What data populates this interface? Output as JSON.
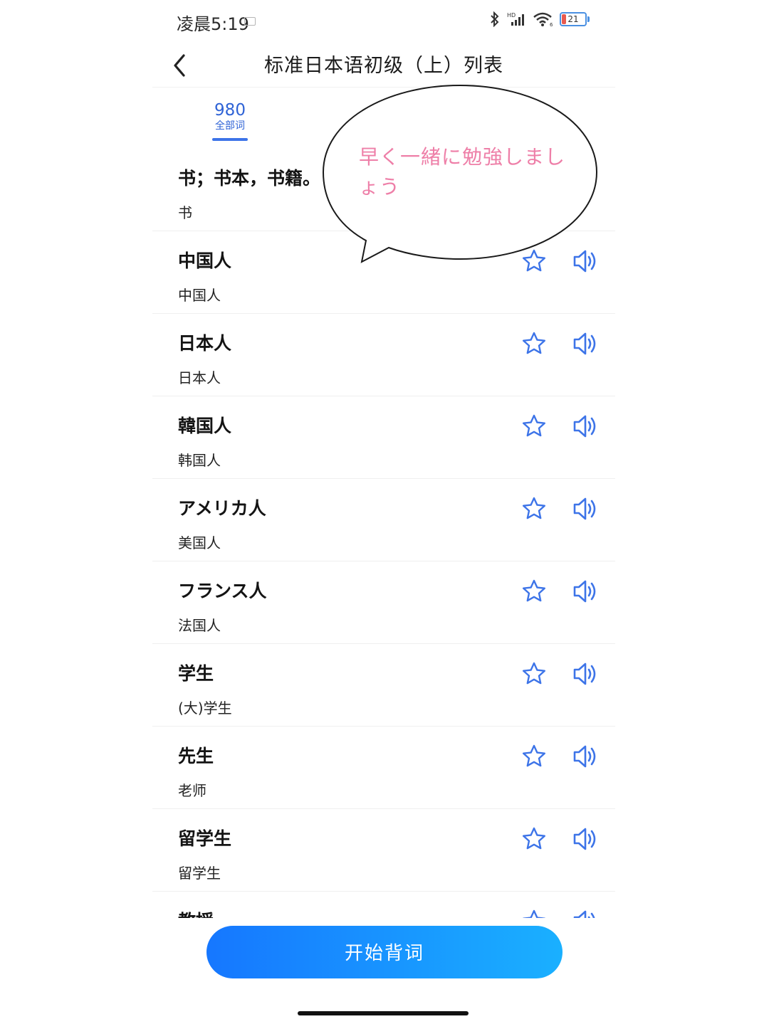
{
  "status_bar": {
    "time": "凌晨5:19",
    "battery": "21"
  },
  "header": {
    "title": "标准日本语初级（上）列表"
  },
  "tabs": [
    {
      "count": "980",
      "label": "全部词"
    }
  ],
  "bubble": {
    "text": "早く一緒に勉強しましょう"
  },
  "words": [
    {
      "jp": "书；书本，书籍。",
      "cn": "书"
    },
    {
      "jp": "中国人",
      "cn": "中国人"
    },
    {
      "jp": "日本人",
      "cn": "日本人"
    },
    {
      "jp": "韓国人",
      "cn": "韩国人"
    },
    {
      "jp": "アメリカ人",
      "cn": "美国人"
    },
    {
      "jp": "フランス人",
      "cn": "法国人"
    },
    {
      "jp": "学生",
      "cn": "(大)学生"
    },
    {
      "jp": "先生",
      "cn": "老师"
    },
    {
      "jp": "留学生",
      "cn": "留学生"
    },
    {
      "jp": "教授",
      "cn": ""
    }
  ],
  "footer": {
    "start_label": "开始背词"
  },
  "colors": {
    "accent": "#2f63d6",
    "icon_blue": "#3d74e8",
    "button_gradient_start": "#1677ff",
    "button_gradient_end": "#1ab0ff",
    "bubble_text": "#ee7fa8"
  },
  "icons": {
    "back": "chevron-left-icon",
    "star": "star-outline-icon",
    "sound": "speaker-icon"
  }
}
